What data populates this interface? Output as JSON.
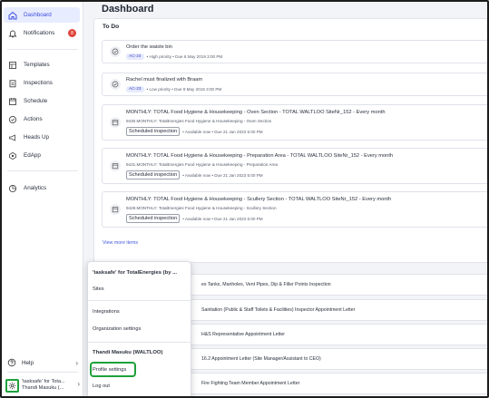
{
  "sidebar": {
    "items": [
      {
        "label": "Dashboard",
        "icon": "home-icon"
      },
      {
        "label": "Notifications",
        "icon": "bell-icon",
        "badge": "8"
      },
      {
        "label": "Templates",
        "icon": "templates-icon"
      },
      {
        "label": "Inspections",
        "icon": "clipboard-icon"
      },
      {
        "label": "Schedule",
        "icon": "calendar-icon"
      },
      {
        "label": "Actions",
        "icon": "check-circle-icon"
      },
      {
        "label": "Heads Up",
        "icon": "megaphone-icon"
      },
      {
        "label": "EdApp",
        "icon": "edapp-icon"
      },
      {
        "label": "Analytics",
        "icon": "analytics-icon"
      }
    ],
    "help_label": "Help",
    "account_line1": "'tasksafe' for Tota...",
    "account_line2": "Thandi Masuku (..."
  },
  "main": {
    "title": "Dashboard",
    "todo_title": "To Do",
    "tasks": [
      {
        "title": "Order the waiste bin",
        "pill": "AC-24",
        "meta": "• High priority • Due 8 May 2019 3:00 PM"
      },
      {
        "title": "Rachel must finalized with Braam",
        "pill": "AC-23",
        "meta": "• Low priority • Due 9 May 2019 3:00 PM"
      },
      {
        "title": "MONTHLY: TOTAL Food Hygiene & Housekeeping - Oven Section - TOTAL WALTLOO SiteNr_152 - Every month",
        "sub": "9430.MONTHLY: TotalEnergies Food Hygiene & Housekeeping - Oven Section",
        "tag": "Scheduled inspection",
        "meta": "• Available now • Due 21 Jan 2023 5:00 PM"
      },
      {
        "title": "MONTHLY: TOTAL Food Hygiene & Housekeeping - Preparation Area - TOTAL WALTLOO SiteNr_152 - Every month",
        "sub": "9431.MONTHLY: TotalEnergies Food Hygiene & Housekeeping - Preparation Area",
        "tag": "Scheduled inspection",
        "meta": "• Available now • Due 21 Jan 2023 5:00 PM"
      },
      {
        "title": "MONTHLY: TOTAL Food Hygiene & Housekeeping - Scullery Section - TOTAL WALTLOO SiteNr_152 - Every month",
        "sub": "9428.MONTHLY: TotalEnergies Food Hygiene & Housekeeping - Scullery Section",
        "tag": "Scheduled inspection",
        "meta": "• Available now • Due 21 Jan 2023 5:00 PM"
      }
    ],
    "view_more": "View more items",
    "rows": [
      "es Tanks, Manholes, Vent Pipes, Dip & Filler Points Inspection",
      "Sanitation (Public & Staff Toilets & Facilities) Inspector Appointment Letter",
      "H&S Representative Appointment Letter",
      "16.2 Appointment Letter (Site Manager/Assistant to CEO)",
      "Fire Fighting Team Member Appointment Letter"
    ]
  },
  "popup": {
    "org_name": "'tasksafe' for TotalEnergies (by ...",
    "sites": "Sites",
    "integrations": "Integrations",
    "org_settings": "Organization settings",
    "user_name": "Thandi Masuku (WALTLOO)",
    "profile_settings": "Profile settings",
    "logout": "Log out"
  },
  "colors": {
    "accent": "#3c4ee0",
    "highlight": "#1ea13a",
    "badge": "#e0443b"
  }
}
